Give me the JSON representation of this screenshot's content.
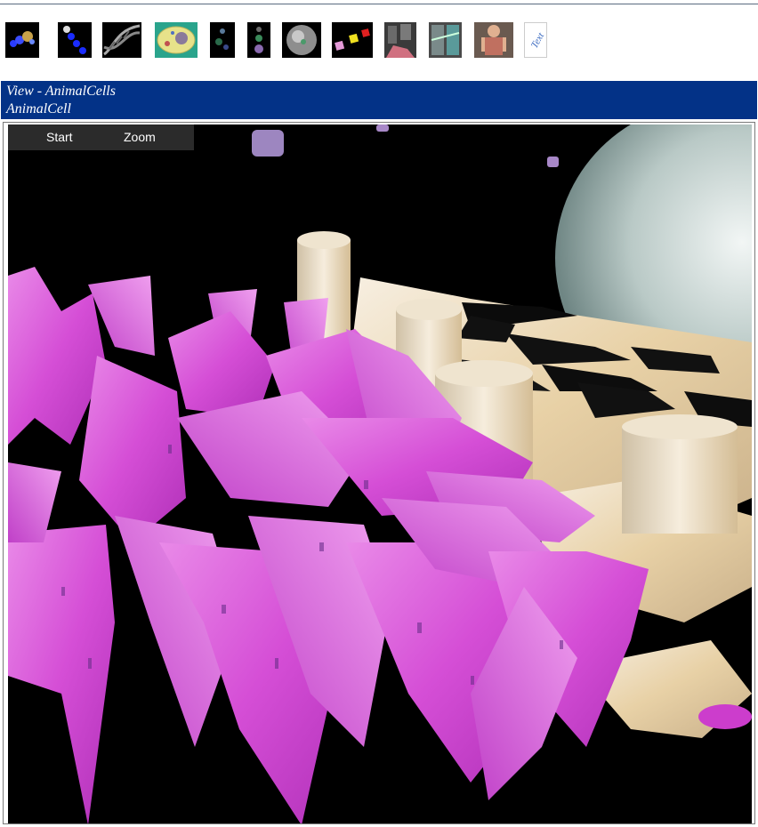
{
  "toolbar": {
    "icons": [
      "molecules-icon",
      "bead-chain-icon",
      "dna-helix-icon",
      "cell-diagram-icon",
      "particles-icon",
      "vertical-spheres-icon",
      "sphere-icon",
      "colored-cubes-icon",
      "anatomy-scene-icon",
      "structure-icon",
      "human-figure-icon",
      "text-icon"
    ],
    "text_label": "Text"
  },
  "header": {
    "view_title": "View - AnimalCells",
    "subtitle": "AnimalCell"
  },
  "viewer": {
    "start_label": "Start",
    "zoom_label": "Zoom"
  },
  "colors": {
    "header_bg": "#033287",
    "membrane": "#d94be0",
    "organelle": "#e8d9b8",
    "nucleus": "#b7c7c4"
  }
}
